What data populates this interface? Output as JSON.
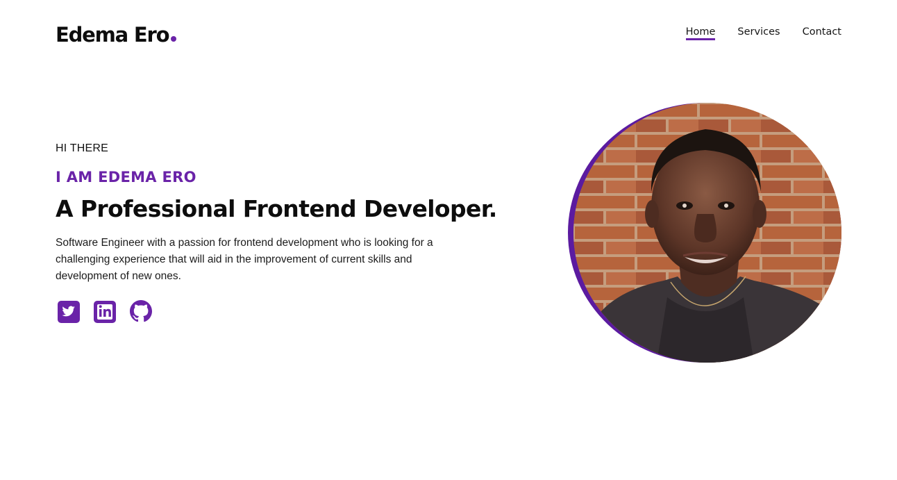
{
  "brand": {
    "name": "Edema Ero",
    "accent_color": "#6a23a8"
  },
  "nav": {
    "items": [
      {
        "label": "Home",
        "active": true
      },
      {
        "label": "Services",
        "active": false
      },
      {
        "label": "Contact",
        "active": false
      }
    ]
  },
  "hero": {
    "greeting": "HI THERE",
    "intro": "I AM EDEMA ERO",
    "headline": "A Professional Frontend Developer.",
    "description": "Software Engineer with a passion for frontend development who is looking for a challenging experience that will aid in the improvement of current skills and development of new ones."
  },
  "social": [
    {
      "icon": "twitter-icon"
    },
    {
      "icon": "linkedin-icon"
    },
    {
      "icon": "github-icon"
    }
  ],
  "portrait": {
    "icon": "profile-photo"
  }
}
